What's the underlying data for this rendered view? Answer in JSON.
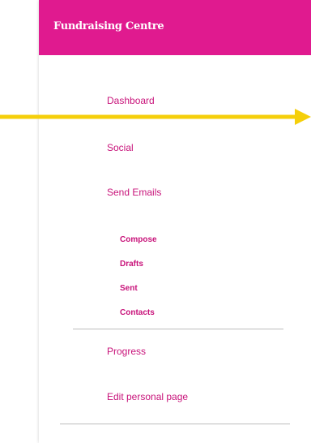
{
  "header": {
    "title": "Fundraising Centre",
    "color": "#e01a8f"
  },
  "nav": {
    "dashboard": "Dashboard",
    "social": "Social",
    "send_emails": "Send Emails",
    "sub": {
      "compose": "Compose",
      "drafts": "Drafts",
      "sent": "Sent",
      "contacts": "Contacts"
    },
    "progress": "Progress",
    "edit_personal_page": "Edit personal page"
  },
  "link_color": "#c8137a",
  "arrow_color": "#f5cf0a"
}
